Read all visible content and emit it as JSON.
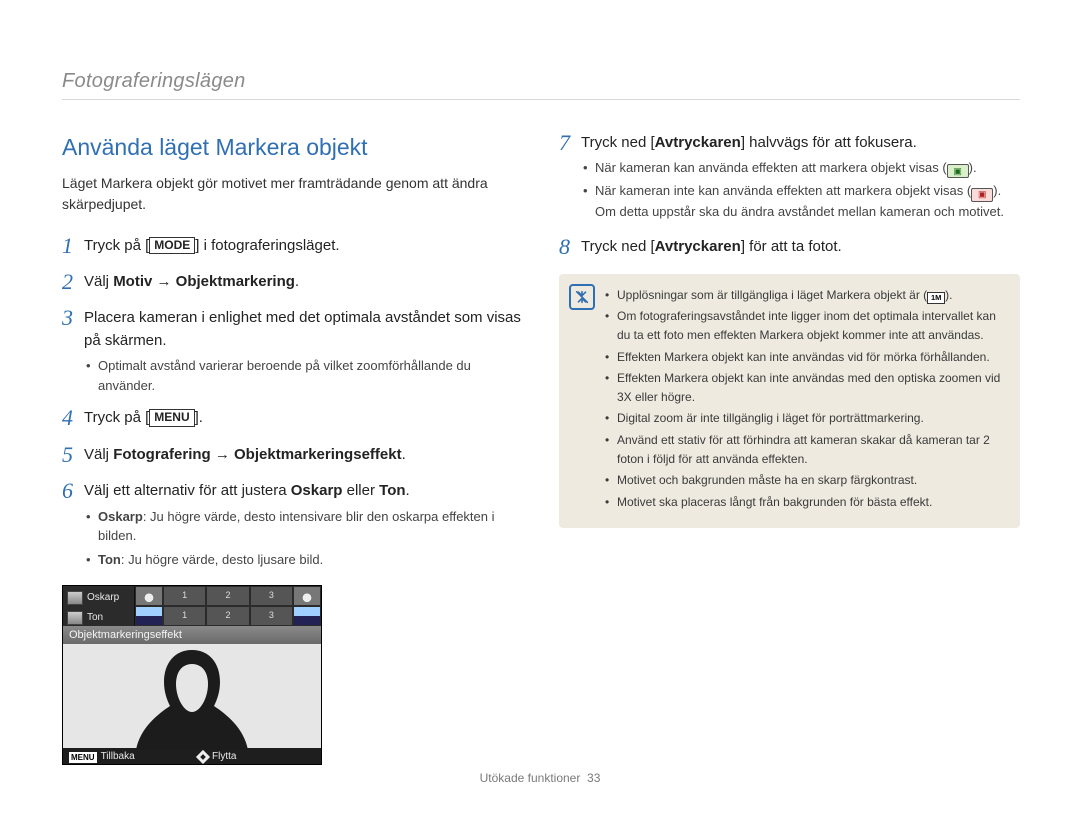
{
  "header": "Fotograferingslägen",
  "section_title": "Använda läget Markera objekt",
  "intro": "Läget Markera objekt gör motivet mer framträdande genom att ändra skärpedjupet.",
  "steps_left": [
    {
      "num": "1",
      "pre": "Tryck på [",
      "button": "MODE",
      "post": "] i fotograferingsläget.",
      "subs": []
    },
    {
      "num": "2",
      "pre": "Välj ",
      "bold": "Motiv → Objektmarkering",
      "post": ".",
      "subs": []
    },
    {
      "num": "3",
      "text": "Placera kameran i enlighet med det optimala avståndet som visas på skärmen.",
      "subs": [
        "Optimalt avstånd varierar beroende på vilket zoomförhållande du använder."
      ]
    },
    {
      "num": "4",
      "pre": "Tryck på [",
      "button": "MENU",
      "post": "].",
      "subs": []
    },
    {
      "num": "5",
      "pre": "Välj ",
      "bold": "Fotografering → Objektmarkeringseffekt",
      "post": ".",
      "subs": []
    },
    {
      "num": "6",
      "pre": "Välj ett alternativ för att justera ",
      "bold": "Oskarp",
      "mid": " eller ",
      "bold2": "Ton",
      "post": ".",
      "subs_labeled": [
        {
          "lead": "Oskarp",
          "text": ": Ju högre värde, desto intensivare blir den oskarpa effekten i bilden."
        },
        {
          "lead": "Ton",
          "text": ": Ju högre värde, desto ljusare bild."
        }
      ]
    }
  ],
  "camera": {
    "row1_label": "Oskarp",
    "row2_label": "Ton",
    "nums": [
      "1",
      "2",
      "3"
    ],
    "banner": "Objektmarkeringseffekt",
    "bottom_menu": "MENU",
    "bottom_back": "Tillbaka",
    "bottom_move": "Flytta"
  },
  "steps_right": [
    {
      "num": "7",
      "parts": [
        "Tryck ned [",
        "Avtryckaren",
        "] halvvägs för att fokusera."
      ],
      "subs": [
        {
          "text_a": "När kameran kan använda effekten att markera objekt visas (",
          "badge": "green",
          "text_b": ")."
        },
        {
          "text_a": "När kameran inte kan använda effekten att markera objekt visas (",
          "badge": "red",
          "text_b": "). Om detta uppstår ska du ändra avståndet mellan kameran och motivet."
        }
      ]
    },
    {
      "num": "8",
      "parts": [
        "Tryck ned [",
        "Avtryckaren",
        "] för att ta fotot."
      ],
      "subs": []
    }
  ],
  "notes": [
    {
      "text_a": "Upplösningar som är tillgängliga i läget Markera objekt är (",
      "badge": "1m",
      "text_b": ")."
    },
    {
      "text": "Om fotograferingsavståndet inte ligger inom det optimala intervallet kan du ta ett foto men effekten Markera objekt kommer inte att användas."
    },
    {
      "text": "Effekten Markera objekt kan inte användas vid för mörka förhållanden."
    },
    {
      "text": "Effekten Markera objekt kan inte användas med den optiska zoomen vid 3X eller högre."
    },
    {
      "text": "Digital zoom är inte tillgänglig i läget för porträttmarkering."
    },
    {
      "text": "Använd ett stativ för att förhindra att kameran skakar då kameran tar 2 foton i följd för att använda effekten."
    },
    {
      "text": "Motivet och bakgrunden måste ha en skarp färgkontrast."
    },
    {
      "text": "Motivet ska placeras långt från bakgrunden för bästa effekt."
    }
  ],
  "footer": {
    "section": "Utökade funktioner",
    "page": "33"
  }
}
